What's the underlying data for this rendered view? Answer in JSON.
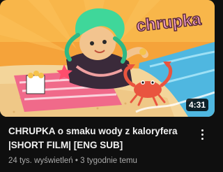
{
  "video": {
    "thumbnail_logo_text": "chrupka",
    "duration": "4:31",
    "title_line1": "CHRUPKA o smaku wody z kaloryfera",
    "title_line2": "|SHORT FILM| [ENG SUB]",
    "views": "24 tys. wyświetleń",
    "separator": "•",
    "age": "3 tygodnie temu"
  },
  "colors": {
    "background": "#0f0f0f",
    "title": "#f1f1f1",
    "meta": "#aaaaaa",
    "thumb_sky": "#f6a83c",
    "sand": "#f3d59a",
    "sea": "#4fb7e0",
    "hair": "#3fd79a",
    "crab": "#e9543f",
    "logo": "#f7a5c8"
  },
  "icons": {
    "more_menu": "vertical-dots-icon"
  }
}
